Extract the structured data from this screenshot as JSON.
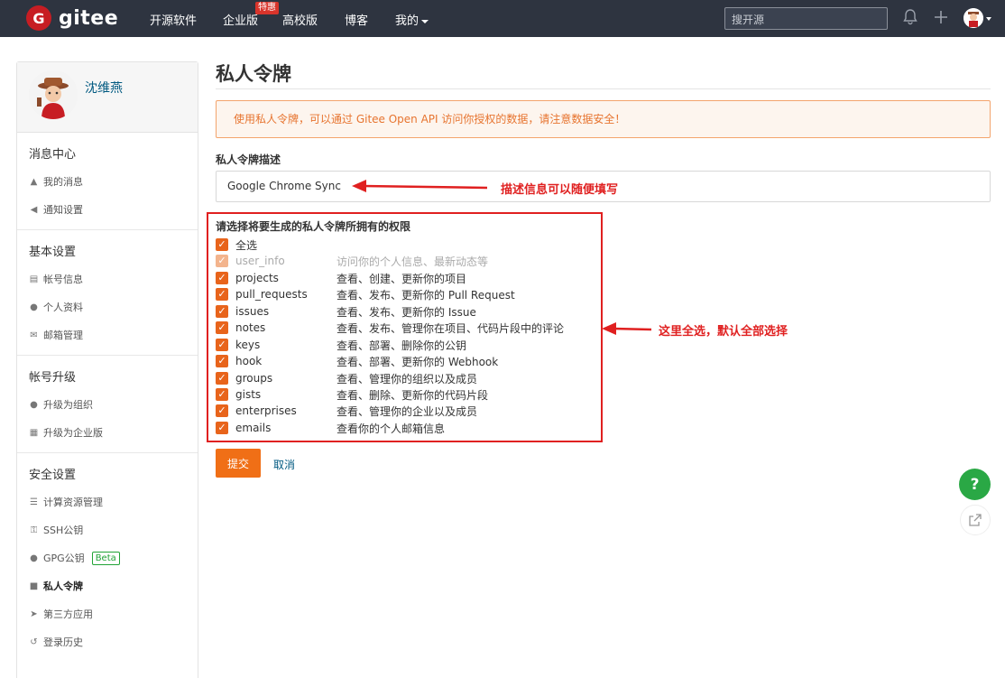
{
  "header": {
    "logo_text": "gitee",
    "nav": [
      {
        "label": "开源软件"
      },
      {
        "label": "企业版",
        "badge": "特惠"
      },
      {
        "label": "高校版"
      },
      {
        "label": "博客"
      },
      {
        "label": "我的"
      }
    ],
    "search_placeholder": "搜开源"
  },
  "sidebar": {
    "user_name": "沈维燕",
    "groups": [
      {
        "title": "消息中心",
        "items": [
          {
            "label": "我的消息",
            "icon": "bell-icon"
          },
          {
            "label": "通知设置",
            "icon": "speaker-icon"
          }
        ]
      },
      {
        "title": "基本设置",
        "items": [
          {
            "label": "帐号信息",
            "icon": "id-card-icon"
          },
          {
            "label": "个人资料",
            "icon": "user-icon"
          },
          {
            "label": "邮箱管理",
            "icon": "envelope-icon"
          }
        ]
      },
      {
        "title": "帐号升级",
        "items": [
          {
            "label": "升级为组织",
            "icon": "users-icon"
          },
          {
            "label": "升级为企业版",
            "icon": "building-icon"
          }
        ]
      },
      {
        "title": "安全设置",
        "items": [
          {
            "label": "计算资源管理",
            "icon": "server-icon"
          },
          {
            "label": "SSH公钥",
            "icon": "key-icon"
          },
          {
            "label": "GPG公钥",
            "icon": "lock-icon",
            "badge": "Beta"
          },
          {
            "label": "私人令牌",
            "icon": "token-icon",
            "active": true
          },
          {
            "label": "第三方应用",
            "icon": "rocket-icon"
          },
          {
            "label": "登录历史",
            "icon": "history-icon"
          }
        ]
      }
    ]
  },
  "main": {
    "title": "私人令牌",
    "alert": "使用私人令牌，可以通过 Gitee Open API 访问你授权的数据，请注意数据安全！",
    "desc_label": "私人令牌描述",
    "desc_value": "Google Chrome Sync",
    "perm_title": "请选择将要生成的私人令牌所拥有的权限",
    "select_all": "全选",
    "permissions": [
      {
        "name": "user_info",
        "desc": "访问你的个人信息、最新动态等",
        "disabled": true
      },
      {
        "name": "projects",
        "desc": "查看、创建、更新你的项目"
      },
      {
        "name": "pull_requests",
        "desc": "查看、发布、更新你的 Pull Request"
      },
      {
        "name": "issues",
        "desc": "查看、发布、更新你的 Issue"
      },
      {
        "name": "notes",
        "desc": "查看、发布、管理你在项目、代码片段中的评论"
      },
      {
        "name": "keys",
        "desc": "查看、部署、删除你的公钥"
      },
      {
        "name": "hook",
        "desc": "查看、部署、更新你的 Webhook"
      },
      {
        "name": "groups",
        "desc": "查看、管理你的组织以及成员"
      },
      {
        "name": "gists",
        "desc": "查看、删除、更新你的代码片段"
      },
      {
        "name": "enterprises",
        "desc": "查看、管理你的企业以及成员"
      },
      {
        "name": "emails",
        "desc": "查看你的个人邮箱信息"
      }
    ],
    "submit_label": "提交",
    "cancel_label": "取消"
  },
  "annotations": {
    "desc_note": "描述信息可以随便填写",
    "perm_note": "这里全选，默认全部选择"
  },
  "colors": {
    "accent": "#f06f16",
    "header_bg": "#2e3440",
    "annotation": "#e02020",
    "help": "#2aa845"
  }
}
